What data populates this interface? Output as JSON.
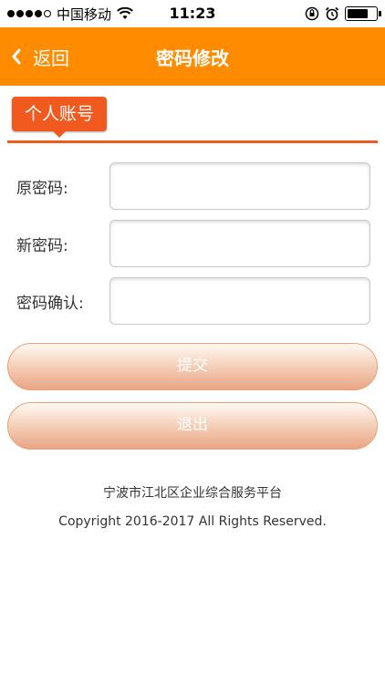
{
  "status_bar": {
    "carrier": "中国移动",
    "time": "11:23",
    "battery_level": 0.75
  },
  "nav": {
    "back_label": "返回",
    "title": "密码修改"
  },
  "section": {
    "tab_label": "个人账号"
  },
  "form": {
    "old_password_label": "原密码:",
    "new_password_label": "新密码:",
    "confirm_password_label": "密码确认:"
  },
  "buttons": {
    "submit_label": "提交",
    "exit_label": "退出"
  },
  "footer": {
    "platform": "宁波市江北区企业综合服务平台",
    "copyright": "Copyright 2016-2017 All Rights Reserved."
  },
  "colors": {
    "nav_bg": "#ff8c00",
    "accent": "#f05a1e"
  }
}
